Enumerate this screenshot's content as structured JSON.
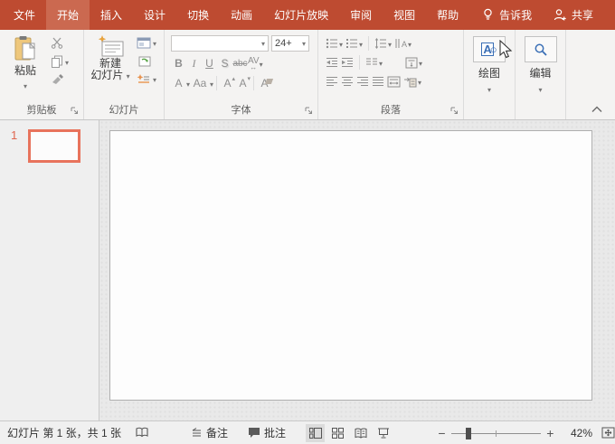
{
  "colors": {
    "titlebar": "#BE4B31",
    "selected_tab_bg": "#CB6950",
    "selected_thumbnail_border": "#E8735C",
    "icon_blue": "#3B6FB6",
    "ribbon_bg": "#F4F3F2"
  },
  "titlebar": {
    "tabs": [
      {
        "label": "文件"
      },
      {
        "label": "开始"
      },
      {
        "label": "插入"
      },
      {
        "label": "设计"
      },
      {
        "label": "切换"
      },
      {
        "label": "动画"
      },
      {
        "label": "幻灯片放映"
      },
      {
        "label": "审阅"
      },
      {
        "label": "视图"
      },
      {
        "label": "帮助"
      }
    ],
    "tell_me": "告诉我",
    "share": "共享"
  },
  "ribbon": {
    "clipboard": {
      "paste_label": "粘贴",
      "group_label": "剪贴板"
    },
    "slides": {
      "new_slide_line1": "新建",
      "new_slide_line2": "幻灯片",
      "group_label": "幻灯片"
    },
    "font": {
      "font_name_value": "",
      "font_size_value": "24+",
      "bold": "B",
      "italic": "I",
      "underline": "U",
      "shadow": "S",
      "strikethrough": "abc",
      "spacing": "AV",
      "font_color": "A",
      "change_case": "Aa",
      "grow_font": "A",
      "shrink_font": "A",
      "clear_format": "A",
      "group_label": "字体"
    },
    "paragraph": {
      "group_label": "段落"
    },
    "drawing": {
      "button_label": "绘图",
      "icon_letter": "A"
    },
    "editing": {
      "button_label": "编辑"
    }
  },
  "slides_panel": {
    "slide_number": "1"
  },
  "statusbar": {
    "slide_info": "幻灯片 第 1 张，共 1 张",
    "notes_label": "备注",
    "comments_label": "批注",
    "zoom_value": "42%"
  }
}
